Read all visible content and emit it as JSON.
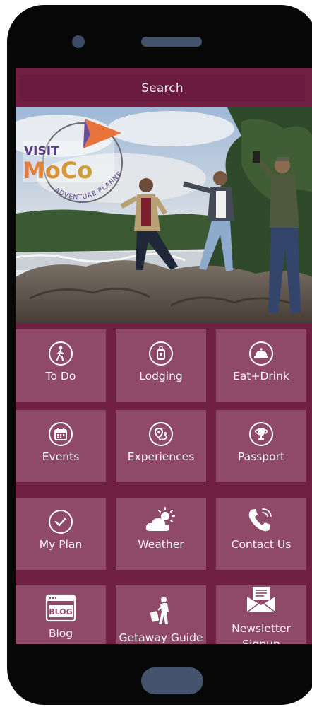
{
  "search": {
    "label": "Search"
  },
  "hero": {
    "logo_visit": "VISIT",
    "logo_moco": "MoCo",
    "logo_tagline": "ADVENTURE PLANNER"
  },
  "tiles": [
    {
      "label": "To Do",
      "icon": "walking-person-icon"
    },
    {
      "label": "Lodging",
      "icon": "hotel-key-icon"
    },
    {
      "label": "Eat+Drink",
      "icon": "food-cloche-icon"
    },
    {
      "label": "Events",
      "icon": "calendar-icon"
    },
    {
      "label": "Experiences",
      "icon": "map-pin-route-icon"
    },
    {
      "label": "Passport",
      "icon": "trophy-icon"
    },
    {
      "label": "My Plan",
      "icon": "checkmark-circle-icon"
    },
    {
      "label": "Weather",
      "icon": "sun-cloud-icon"
    },
    {
      "label": "Contact Us",
      "icon": "phone-icon"
    },
    {
      "label": "Blog",
      "icon": "blog-icon",
      "icon_text": "BLOG"
    },
    {
      "label": "Getaway Guide",
      "icon": "traveler-suitcase-icon"
    },
    {
      "label": "Newsletter Signup",
      "icon": "envelope-icon"
    }
  ],
  "colors": {
    "background": "#6e1f42",
    "tile": "#8f4a69",
    "search_bar": "#6a1b3f",
    "logo_orange": "#e8743b",
    "logo_purple": "#6a4c9c"
  }
}
